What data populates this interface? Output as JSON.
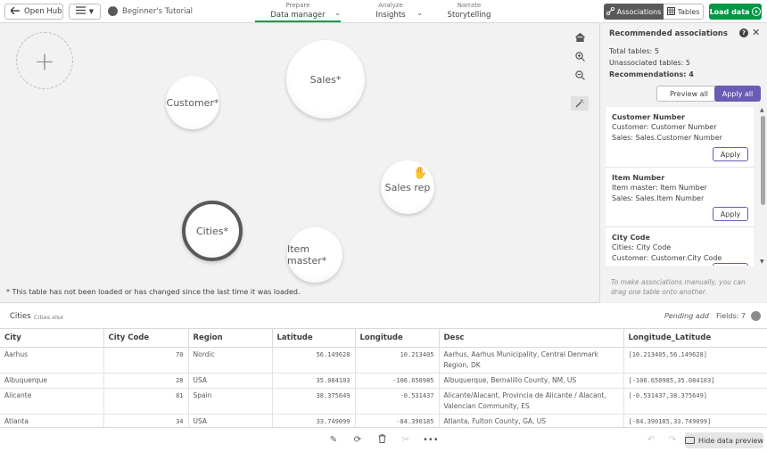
{
  "topbar": {
    "open_hub_label": "Open Hub",
    "app_title": "Beginner's Tutorial",
    "nav": [
      {
        "small": "Prepare",
        "big": "Data manager"
      },
      {
        "small": "Analyze",
        "big": "Insights"
      },
      {
        "small": "Narrate",
        "big": "Storytelling"
      }
    ],
    "associations_label": "Associations",
    "tables_label": "Tables",
    "load_data_label": "Load data",
    "accent_color": "#009845"
  },
  "canvas": {
    "tables": [
      "Sales*",
      "Customer*",
      "Sales rep",
      "Cities*",
      "Item master*"
    ],
    "note": "* This table has not been loaded or has changed since the last time it was loaded."
  },
  "panel": {
    "title": "Recommended associations",
    "total_tables": "Total tables: 5",
    "unassociated_tables": "Unassociated tables: 5",
    "recommendations": "Recommendations: 4",
    "preview_all_label": "Preview all",
    "apply_all_label": "Apply all",
    "apply_label": "Apply",
    "recommendations_list": [
      {
        "title": "Customer Number",
        "line1": "Customer: Customer Number",
        "line2": "Sales: Sales.Customer Number"
      },
      {
        "title": "Item Number",
        "line1": "Item master: Item Number",
        "line2": "Sales: Sales.Item Number"
      },
      {
        "title": "City Code",
        "line1": "Cities: City Code",
        "line2": "Customer: Customer.City Code"
      }
    ],
    "hint": "To make associations manually, you can drag one table onto another."
  },
  "preview": {
    "title": "Cities",
    "file": "Cities.xlsx",
    "status": "Pending add",
    "fields": "Fields: 7",
    "columns": [
      "City",
      "City Code",
      "Region",
      "Latitude",
      "Longitude",
      "Desc",
      "Longitude_Latitude"
    ],
    "rows": [
      [
        "Aarhus",
        "70",
        "Nordic",
        "56.149628",
        "10.213405",
        "Aarhus, Aarhus Municipality, Central Denmark Region, DK",
        "[10.213405,56.149628]"
      ],
      [
        "Albuquerque",
        "28",
        "USA",
        "35.084103",
        "-106.650985",
        "Albuquerque, Bernalillo County, NM, US",
        "[-106.650985,35.084103]"
      ],
      [
        "Alicante",
        "81",
        "Spain",
        "38.375649",
        "-0.531437",
        "Alicante/Alacant, Provincia de Alicante / Alacant, Valencian Community, ES",
        "[-0.531437,38.375649]"
      ],
      [
        "Atlanta",
        "34",
        "USA",
        "33.749099",
        "-84.390185",
        "Atlanta, Fulton County, GA, US",
        "[-84.390185,33.749099]"
      ]
    ]
  },
  "bottombar": {
    "hide_preview_label": "Hide data preview"
  }
}
